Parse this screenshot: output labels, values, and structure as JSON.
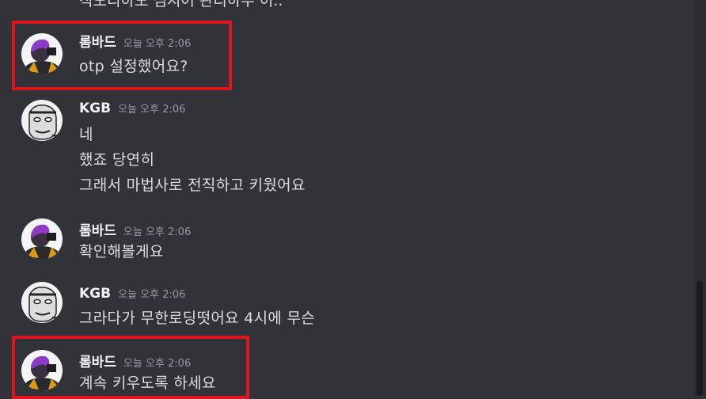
{
  "chat": {
    "clipped_line": "직도리하도 심지어 관리하두 이..",
    "messages": [
      {
        "author": "롬바드",
        "timestamp": "오늘 오후 2:06",
        "lines": [
          "otp 설정했어요?"
        ]
      },
      {
        "author": "KGB",
        "timestamp": "오늘 오후 2:06",
        "lines": [
          "네",
          "했죠 당연히",
          "그래서 마법사로 전직하고 키웠어요"
        ]
      },
      {
        "author": "롬바드",
        "timestamp": "오늘 오후 2:06",
        "lines": [
          "확인해볼게요"
        ]
      },
      {
        "author": "KGB",
        "timestamp": "오늘 오후 2:06",
        "lines": [
          "그라다가 무한로딩떳어요 4시에 무슨"
        ]
      },
      {
        "author": "롬바드",
        "timestamp": "오늘 오후 2:06",
        "lines": [
          "계속 키우도록 하세요"
        ]
      }
    ]
  },
  "colors": {
    "background": "#313338",
    "highlight_box": "#e0141c",
    "author_text": "#f2f3f5",
    "timestamp_text": "#949ba4"
  },
  "icons": {
    "rombad_avatar": "purple-hair-character-avatar",
    "kgb_avatar": "manga-face-avatar"
  }
}
